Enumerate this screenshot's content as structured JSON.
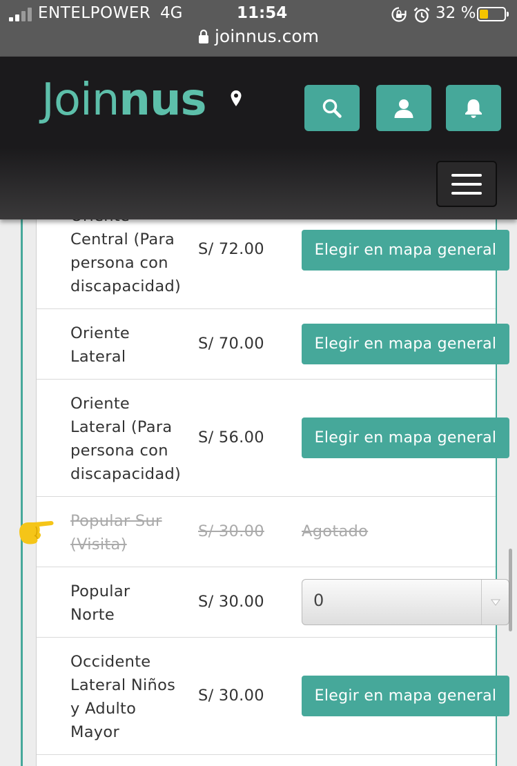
{
  "status_bar": {
    "carrier": "ENTELPOWER",
    "network": "4G",
    "time": "11:54",
    "battery": "32 %",
    "battery_level": 0.32,
    "url": "joinnus.com",
    "icons": [
      "signal-icon",
      "rotation-lock-icon",
      "alarm-icon",
      "battery-icon",
      "lock-icon"
    ]
  },
  "header": {
    "logo_light": "Join",
    "logo_bold": "nus",
    "icons": [
      "location-pin-icon",
      "search-icon",
      "user-icon",
      "bell-icon",
      "hamburger-menu-icon"
    ]
  },
  "tickets": [
    {
      "zone": "Oriente Central (Para persona con discapacidad)",
      "zone_lines": [
        "Central (Para",
        "persona con",
        "discapacidad)"
      ],
      "clipped_line": "Oriente",
      "price": "S/ 72.00",
      "action": "Elegir en mapa general"
    },
    {
      "zone_lines": [
        "Oriente",
        "Lateral"
      ],
      "price": "S/ 70.00",
      "action": "Elegir en mapa general"
    },
    {
      "zone_lines": [
        "Oriente",
        "Lateral (Para",
        "persona con",
        "discapacidad)"
      ],
      "price": "S/ 56.00",
      "action": "Elegir en mapa general"
    },
    {
      "zone_lines": [
        "Popular Sur",
        "(Visita)"
      ],
      "price": "S/ 30.00",
      "status": "Agotado"
    },
    {
      "zone_lines": [
        "Popular",
        "Norte"
      ],
      "price": "S/ 30.00",
      "quantity": "0"
    },
    {
      "zone_lines": [
        "Occidente",
        "Lateral Niños",
        "y Adulto",
        "Mayor"
      ],
      "price": "S/ 30.00",
      "action": "Elegir en mapa general"
    }
  ],
  "colors": {
    "accent": "#46a89a",
    "logo": "#5dbfaa",
    "header_bg": "#1b1a1c",
    "pointer": "#f5c518"
  }
}
